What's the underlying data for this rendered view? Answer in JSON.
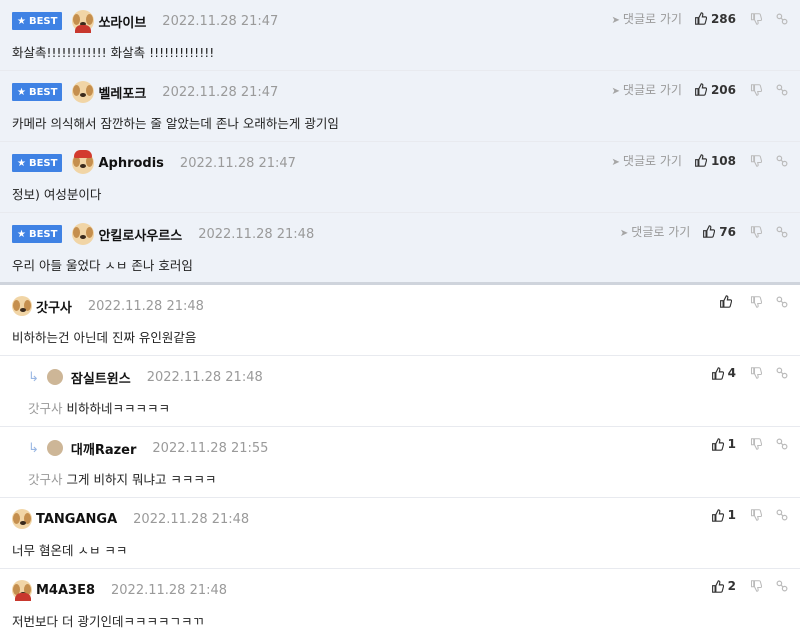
{
  "labels": {
    "best": "BEST",
    "goto_comment": "댓글로 가기"
  },
  "comments": [
    {
      "best": true,
      "nick": "쏘라이브",
      "date": "2022.11.28 21:47",
      "likes": "286",
      "text": "화살촉!!!!!!!!!!!! 화살촉 !!!!!!!!!!!!!"
    },
    {
      "best": true,
      "nick": "벨레포크",
      "date": "2022.11.28 21:47",
      "likes": "206",
      "text": "카메라 의식해서 잠깐하는 줄 알았는데 존나 오래하는게 광기임"
    },
    {
      "best": true,
      "nick": "Aphrodis",
      "date": "2022.11.28 21:47",
      "likes": "108",
      "text": "정보) 여성분이다"
    },
    {
      "best": true,
      "nick": "안킬로사우르스",
      "date": "2022.11.28 21:48",
      "likes": "76",
      "text": "우리 아들 울었다 ㅅㅂ 존나 호러임"
    },
    {
      "best": false,
      "nick": "갓구사",
      "date": "2022.11.28 21:48",
      "likes": "",
      "text": "비하하는건 아닌데 진짜 유인원같음"
    },
    {
      "best": false,
      "reply": true,
      "nick": "잠실트윈스",
      "date": "2022.11.28 21:48",
      "likes": "4",
      "mention": "갓구사",
      "text": "비하하네ㅋㅋㅋㅋㅋ"
    },
    {
      "best": false,
      "reply": true,
      "nick": "대깨Razer",
      "date": "2022.11.28 21:55",
      "likes": "1",
      "mention": "갓구사",
      "text": "그게 비하지 뭐냐고 ㅋㅋㅋㅋ"
    },
    {
      "best": false,
      "nick": "TANGANGA",
      "date": "2022.11.28 21:48",
      "likes": "1",
      "text": "너무 혐온데 ㅅㅂ ㅋㅋ"
    },
    {
      "best": false,
      "nick": "M4A3E8",
      "date": "2022.11.28 21:48",
      "likes": "2",
      "text": "저번보다 더 광기인데ㅋㅋㅋㅋㄱㅋㄲ"
    }
  ]
}
